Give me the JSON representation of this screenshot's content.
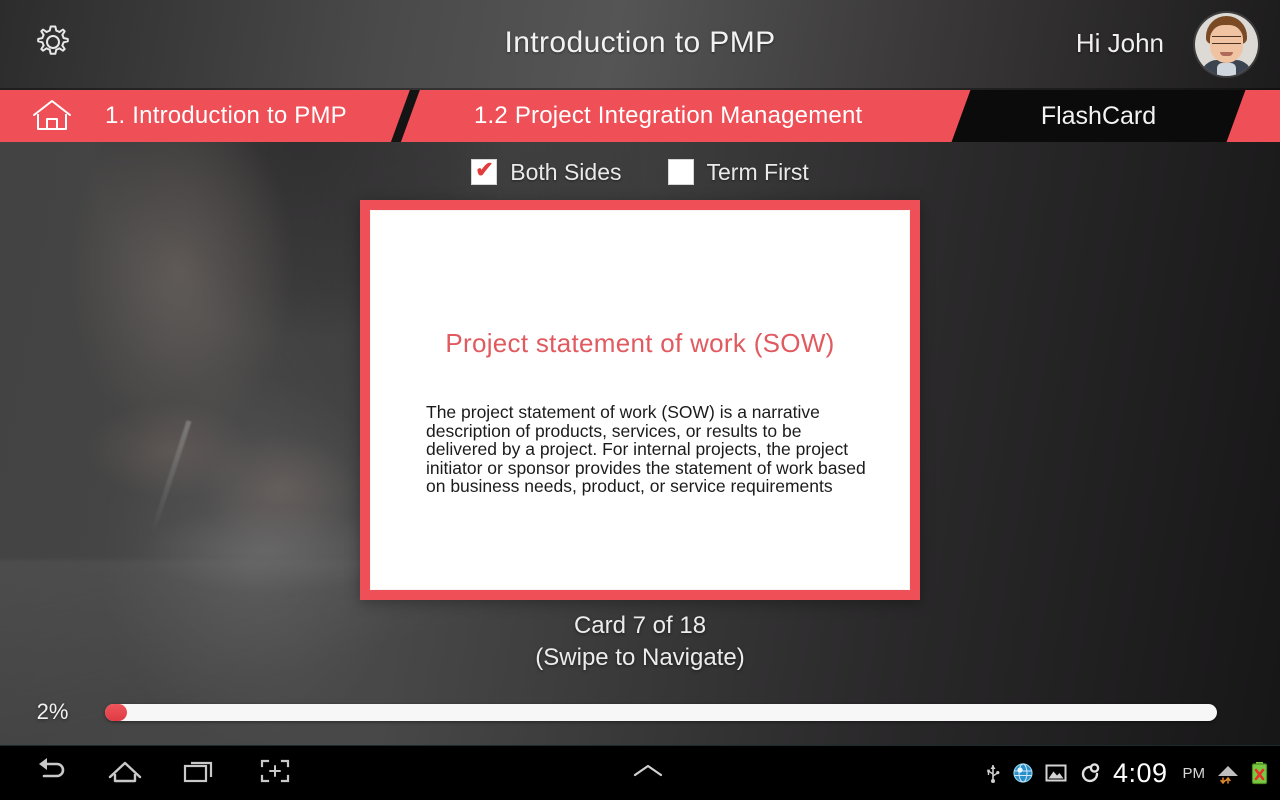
{
  "header": {
    "settings_icon": "gear-icon",
    "title": "Introduction to PMP",
    "greeting": "Hi John",
    "avatar_icon": "user-avatar"
  },
  "breadcrumb": {
    "home_icon": "home-icon",
    "items": [
      {
        "label": "1. Introduction to PMP"
      },
      {
        "label": "1.2 Project Integration Management"
      }
    ],
    "active_tab": "FlashCard"
  },
  "options": [
    {
      "label": "Both Sides",
      "checked": true
    },
    {
      "label": "Term First",
      "checked": false
    }
  ],
  "flashcard": {
    "title": "Project statement of work (SOW)",
    "body": "The project statement of work (SOW) is a narrative description of products, services, or results to be delivered by a project. For internal projects, the project initiator or sponsor provides the statement of work based on business needs, product, or service requirements",
    "counter": "Card 7 of 18",
    "hint": "(Swipe to Navigate)"
  },
  "progress": {
    "percent_label": "2%",
    "percent_value": 2
  },
  "navbar": {
    "back_icon": "back-arrow-icon",
    "home_icon": "home-icon",
    "recents_icon": "recent-apps-icon",
    "screenshot_icon": "screenshot-icon",
    "expand_icon": "chevron-up-icon",
    "status_icons": [
      "usb-icon",
      "app-globe-icon",
      "gallery-image-icon",
      "sync-loop-icon",
      "wifi-icon",
      "battery-error-icon"
    ],
    "time": "4:09",
    "meridiem": "PM"
  },
  "colors": {
    "accent_red": "#ef4f56",
    "card_title_red": "#e05a5f",
    "tab_black": "#0b0b0b",
    "header_dark": "#3a3838"
  }
}
